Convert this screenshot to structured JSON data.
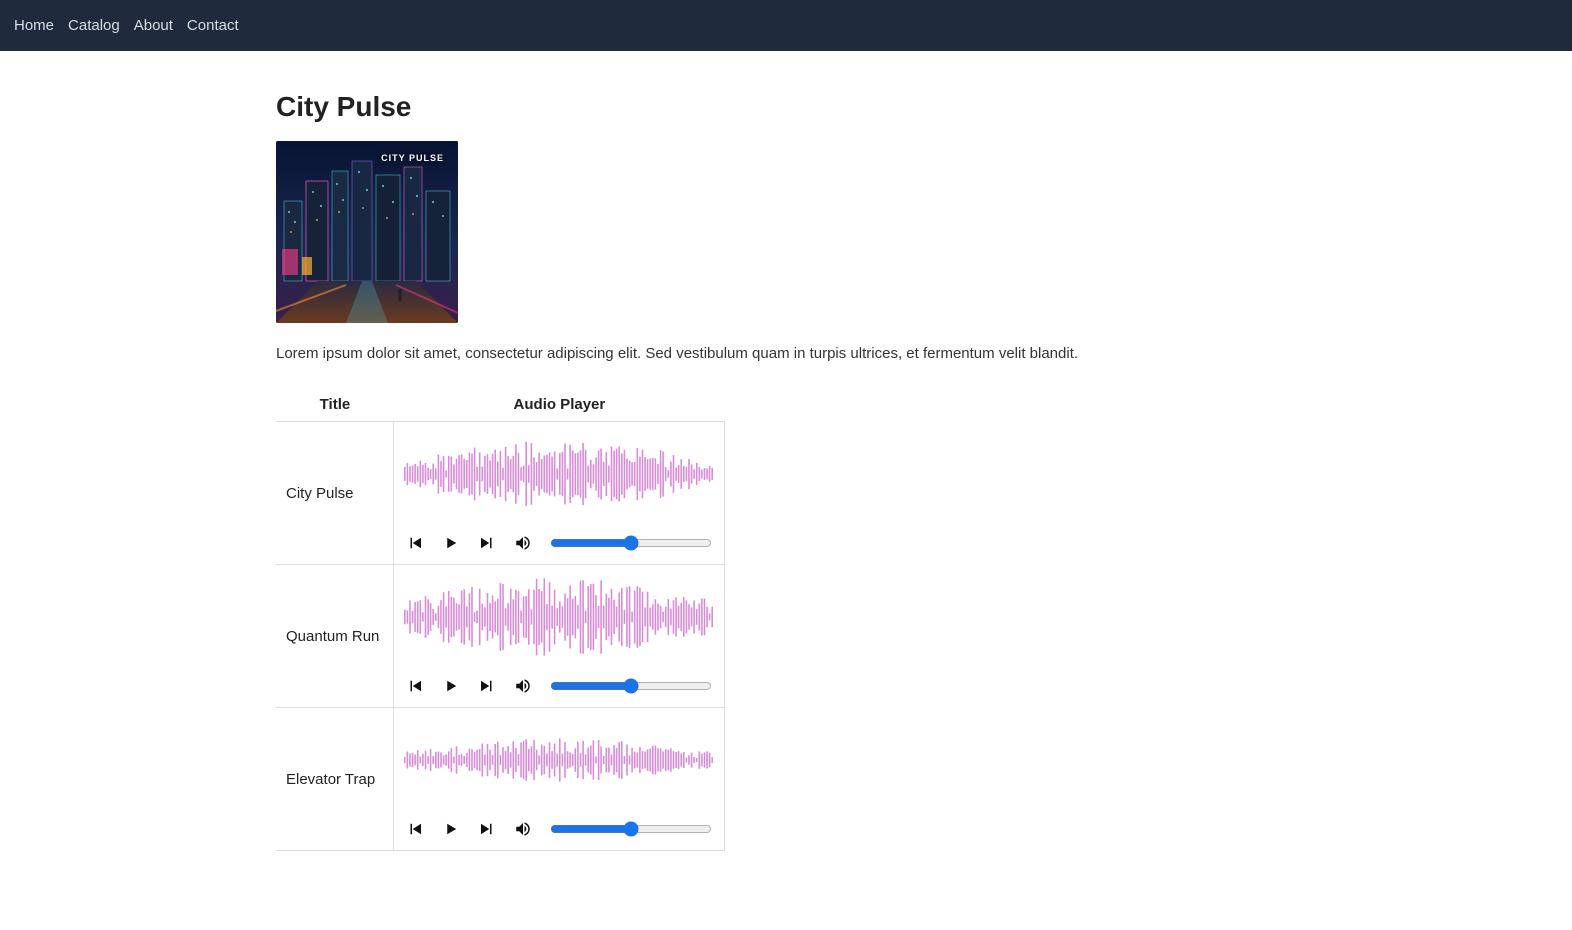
{
  "nav": {
    "items": [
      {
        "label": "Home"
      },
      {
        "label": "Catalog"
      },
      {
        "label": "About"
      },
      {
        "label": "Contact"
      }
    ]
  },
  "page": {
    "title": "City Pulse",
    "art_title": "CITY PULSE",
    "description": "Lorem ipsum dolor sit amet, consectetur adipiscing elit. Sed vestibulum quam in turpis ultrices, et fermentum velit blandit."
  },
  "table": {
    "headers": {
      "title": "Title",
      "player": "Audio Player"
    }
  },
  "tracks": [
    {
      "title": "City Pulse",
      "volume": 50,
      "wave_seed": 1,
      "wave_amp": 0.85
    },
    {
      "title": "Quantum Run",
      "volume": 50,
      "wave_seed": 2,
      "wave_amp": 1.0
    },
    {
      "title": "Elevator Trap",
      "volume": 50,
      "wave_seed": 3,
      "wave_amp": 0.55
    }
  ],
  "colors": {
    "wave": "#d98bd9"
  }
}
